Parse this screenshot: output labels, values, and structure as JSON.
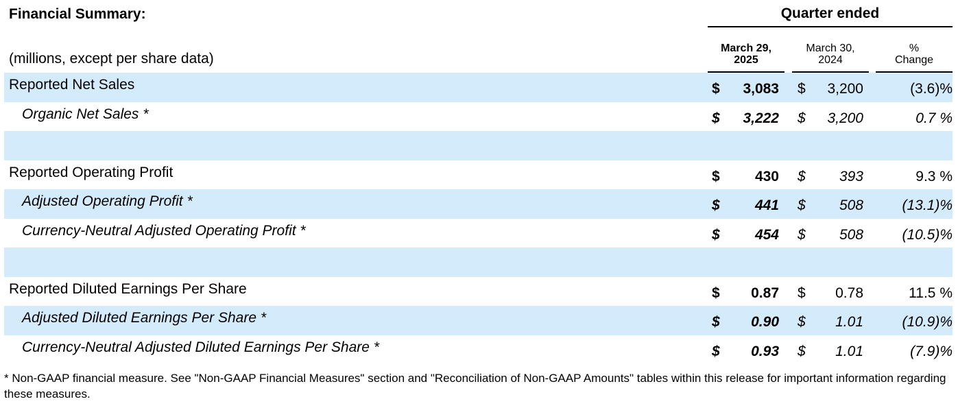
{
  "title": "Financial Summary:",
  "units": "(millions, except per share data)",
  "quarter_header": "Quarter ended",
  "columns": {
    "current": [
      "March 29,",
      "2025"
    ],
    "prior": [
      "March 30,",
      "2024"
    ],
    "change": [
      "%",
      "Change"
    ]
  },
  "rows": [
    {
      "label": "Reported Net Sales",
      "d1": "$",
      "v1": "3,083",
      "d2": "$",
      "v2": "3,200",
      "pc": "(3.6)%"
    },
    {
      "label": "Organic Net Sales *",
      "d1": "$",
      "v1": "3,222",
      "d2": "$",
      "v2": "3,200",
      "pc": "0.7 %"
    },
    {
      "label": "",
      "d1": "",
      "v1": "",
      "d2": "",
      "v2": "",
      "pc": ""
    },
    {
      "label": "Reported Operating Profit",
      "d1": "$",
      "v1": "430",
      "d2": "$",
      "v2": "393",
      "pc": "9.3 %"
    },
    {
      "label": "Adjusted Operating Profit *",
      "d1": "$",
      "v1": "441",
      "d2": "$",
      "v2": "508",
      "pc": "(13.1)%"
    },
    {
      "label": "Currency-Neutral Adjusted Operating Profit *",
      "d1": "$",
      "v1": "454",
      "d2": "$",
      "v2": "508",
      "pc": "(10.5)%"
    },
    {
      "label": "",
      "d1": "",
      "v1": "",
      "d2": "",
      "v2": "",
      "pc": ""
    },
    {
      "label": "Reported Diluted Earnings Per Share",
      "d1": "$",
      "v1": "0.87",
      "d2": "$",
      "v2": "0.78",
      "pc": "11.5 %"
    },
    {
      "label": "Adjusted Diluted Earnings Per Share *",
      "d1": "$",
      "v1": "0.90",
      "d2": "$",
      "v2": "1.01",
      "pc": "(10.9)%"
    },
    {
      "label": "Currency-Neutral Adjusted Diluted Earnings Per Share *",
      "d1": "$",
      "v1": "0.93",
      "d2": "$",
      "v2": "1.01",
      "pc": "(7.9)%"
    }
  ],
  "footnote": "* Non-GAAP financial measure. See \"Non-GAAP Financial Measures\" section and \"Reconciliation of Non-GAAP Amounts\" tables within this release for important information regarding these measures.",
  "colors": {
    "row_shade": "#d4ebfb"
  }
}
